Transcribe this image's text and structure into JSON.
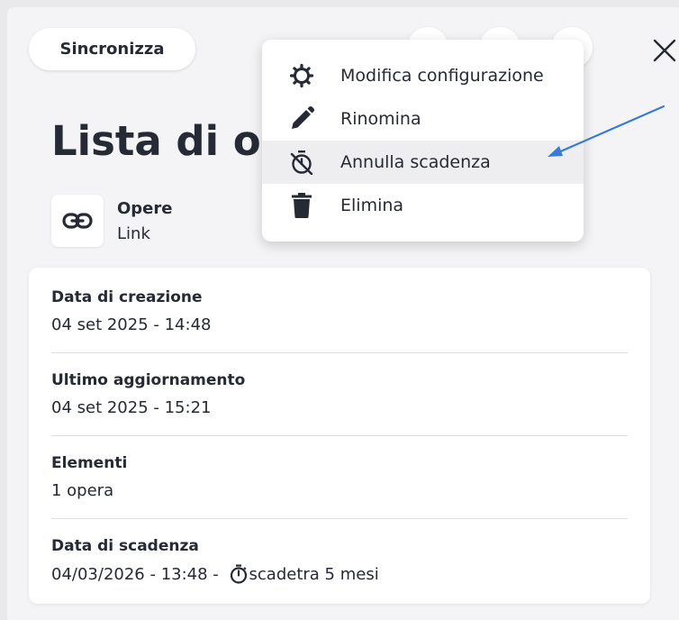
{
  "toolbar": {
    "sync_label": "Sincronizza",
    "close_icon": "close-icon"
  },
  "header": {
    "title": "Lista di op"
  },
  "link": {
    "name": "Opere",
    "type": "Link",
    "icon": "link-icon"
  },
  "info": {
    "created_label": "Data di creazione",
    "created_value": "04 set 2025 - 14:48",
    "updated_label": "Ultimo aggiornamento",
    "updated_value": "04 set 2025 - 15:21",
    "items_label": "Elementi",
    "items_value": "1 opera",
    "expiry_label": "Data di scadenza",
    "expiry_date": "04/03/2026",
    "expiry_sep1": " - ",
    "expiry_time": "13:48",
    "expiry_sep2": " - ",
    "expiry_remaining": "scadetra 5 mesi",
    "expiry_icon": "timer-icon"
  },
  "menu": {
    "items": [
      {
        "label": "Modifica configurazione",
        "icon": "gear-icon"
      },
      {
        "label": "Rinomina",
        "icon": "pencil-icon"
      },
      {
        "label": "Annulla scadenza",
        "icon": "timer-off-icon",
        "highlighted": true
      },
      {
        "label": "Elimina",
        "icon": "trash-icon"
      }
    ]
  },
  "colors": {
    "text": "#262a35",
    "background": "#f4f4f6",
    "card": "#ffffff",
    "highlight": "#eeeef1",
    "arrow": "#3a7bd5"
  }
}
